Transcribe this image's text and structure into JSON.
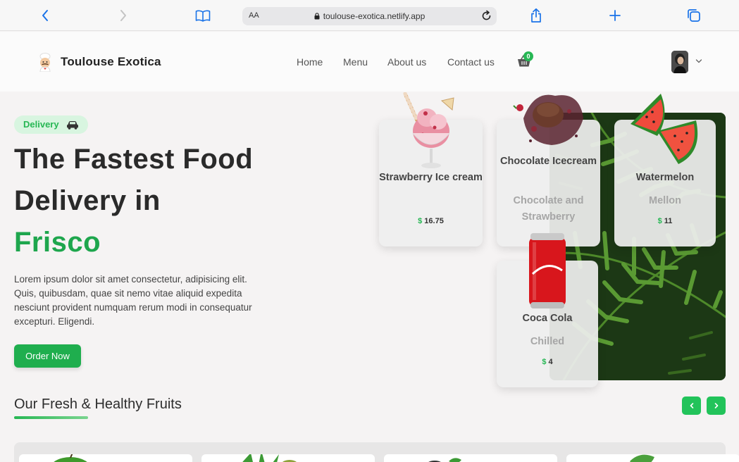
{
  "browser": {
    "url": "toulouse-exotica.netlify.app",
    "text_size_label": "AA",
    "icons": [
      "back-icon",
      "forward-icon",
      "bookmarks-icon",
      "lock-icon",
      "reload-icon",
      "share-icon",
      "new-tab-icon",
      "tabs-icon"
    ]
  },
  "header": {
    "brand": "Toulouse Exotica",
    "nav": [
      "Home",
      "Menu",
      "About us",
      "Contact us"
    ],
    "cart_count": "0"
  },
  "hero": {
    "badge": "Delivery",
    "title_line1": "The Fastest Food",
    "title_line2": "Delivery in",
    "city": "Frisco",
    "description": "Lorem ipsum dolor sit amet consectetur, adipisicing elit. Quis, quibusdam, quae sit nemo vitae aliquid expedita nesciunt provident numquam rerum modi in consequatur excepturi. Eligendi.",
    "cta": "Order Now"
  },
  "cards": [
    {
      "name": "Strawberry Ice cream",
      "description": "",
      "currency": "$",
      "price": "16.75"
    },
    {
      "name": "Chocolate Icecream",
      "description": "Chocolate and Strawberry",
      "currency": "",
      "price": ""
    },
    {
      "name": "Watermelon",
      "description": "Mellon",
      "currency": "$",
      "price": "11"
    },
    {
      "name": "Coca Cola",
      "description": "Chilled",
      "currency": "$",
      "price": "4"
    }
  ],
  "section": {
    "title": "Our Fresh & Healthy Fruits"
  },
  "colors": {
    "accent": "#1ea64d",
    "badge_bg": "#d8f5e0",
    "browser_blue": "#1a73e8"
  }
}
